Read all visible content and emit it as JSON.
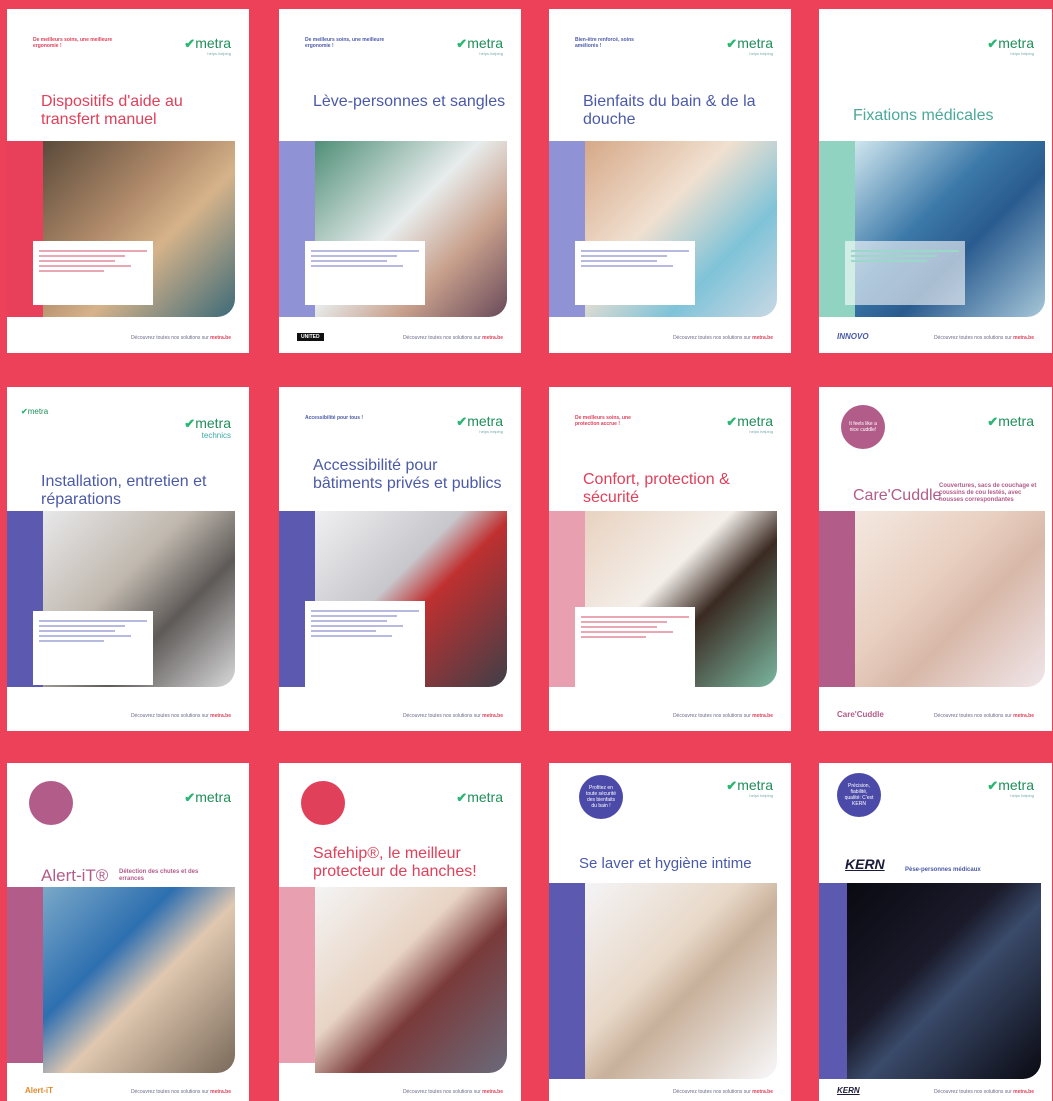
{
  "cards": [
    {
      "tagline": "De meilleurs soins, une meilleure ergonomie !",
      "title": "Dispositifs d'aide au transfert manuel",
      "footer": "Découvrez toutes nos solutions sur",
      "footer_link": "metra.be",
      "logo": "metra"
    },
    {
      "tagline": "De meilleurs soins, une meilleure ergonomie !",
      "title": "Lève-personnes et sangles",
      "footer": "Découvrez toutes nos solutions sur",
      "footer_link": "metra.be",
      "logo": "metra",
      "brand": "UNITED"
    },
    {
      "tagline": "Bien-être renforcé, soins améliorés !",
      "title": "Bienfaits du bain & de la douche",
      "footer": "Découvrez toutes nos solutions sur",
      "footer_link": "metra.be",
      "logo": "metra"
    },
    {
      "tagline": "",
      "title": "Fixations médicales",
      "footer": "Découvrez toutes nos solutions sur",
      "footer_link": "metra.be",
      "logo": "metra",
      "brand": "INNOVO"
    },
    {
      "tagline": "",
      "title": "Installation, entretien et réparations",
      "footer": "Découvrez toutes nos solutions sur",
      "footer_link": "metra.be",
      "logo": "metra",
      "logo_sub": "technics"
    },
    {
      "tagline": "Accessibilité pour tous !",
      "title": "Accessibilité pour bâtiments privés et publics",
      "footer": "Découvrez toutes nos solutions sur",
      "footer_link": "metra.be",
      "logo": "metra"
    },
    {
      "tagline": "De meilleurs soins, une protection accrue !",
      "title": "Confort, protection & sécurité",
      "footer": "Découvrez toutes nos solutions sur",
      "footer_link": "metra.be",
      "logo": "metra"
    },
    {
      "badge": "It feels like a nice cuddle!",
      "title": "Care'Cuddle",
      "sublabel": "Couvertures, sacs de couchage et coussins de cou lestés, avec housses correspondantes",
      "footer": "Découvrez toutes nos solutions sur",
      "footer_link": "metra.be",
      "logo": "metra",
      "brand": "Care'Cuddle"
    },
    {
      "badge": "",
      "title": "Alert-iT®",
      "sublabel": "Détection des chutes et des errances",
      "footer": "Découvrez toutes nos solutions sur",
      "footer_link": "metra.be",
      "logo": "metra",
      "brand": "Alert-iT"
    },
    {
      "badge": "",
      "title": "Safehip®, le meilleur protecteur de hanches!",
      "footer": "Découvrez toutes nos solutions sur",
      "footer_link": "metra.be",
      "logo": "metra"
    },
    {
      "badge": "Profitez en toute sécurité des bienfaits du bain !",
      "title": "Se laver et hygiène intime",
      "footer": "Découvrez toutes nos solutions sur",
      "footer_link": "metra.be",
      "logo": "metra"
    },
    {
      "badge": "Précision, fiabilité, qualité: C'est KERN",
      "title": "KERN",
      "sublabel": "Pèse-personnes médicaux",
      "footer": "Découvrez toutes nos solutions sur",
      "footer_link": "metra.be",
      "logo": "metra",
      "brand": "KERN"
    }
  ],
  "colors": {
    "background": "#ec4158",
    "title": "#e0405a",
    "title_blue": "#4b5aa8",
    "band_purple": "#5b5ab0",
    "band_pink": "#b25c8a",
    "logo_green": "#2bb673"
  },
  "logo_tagline": "helps helping"
}
